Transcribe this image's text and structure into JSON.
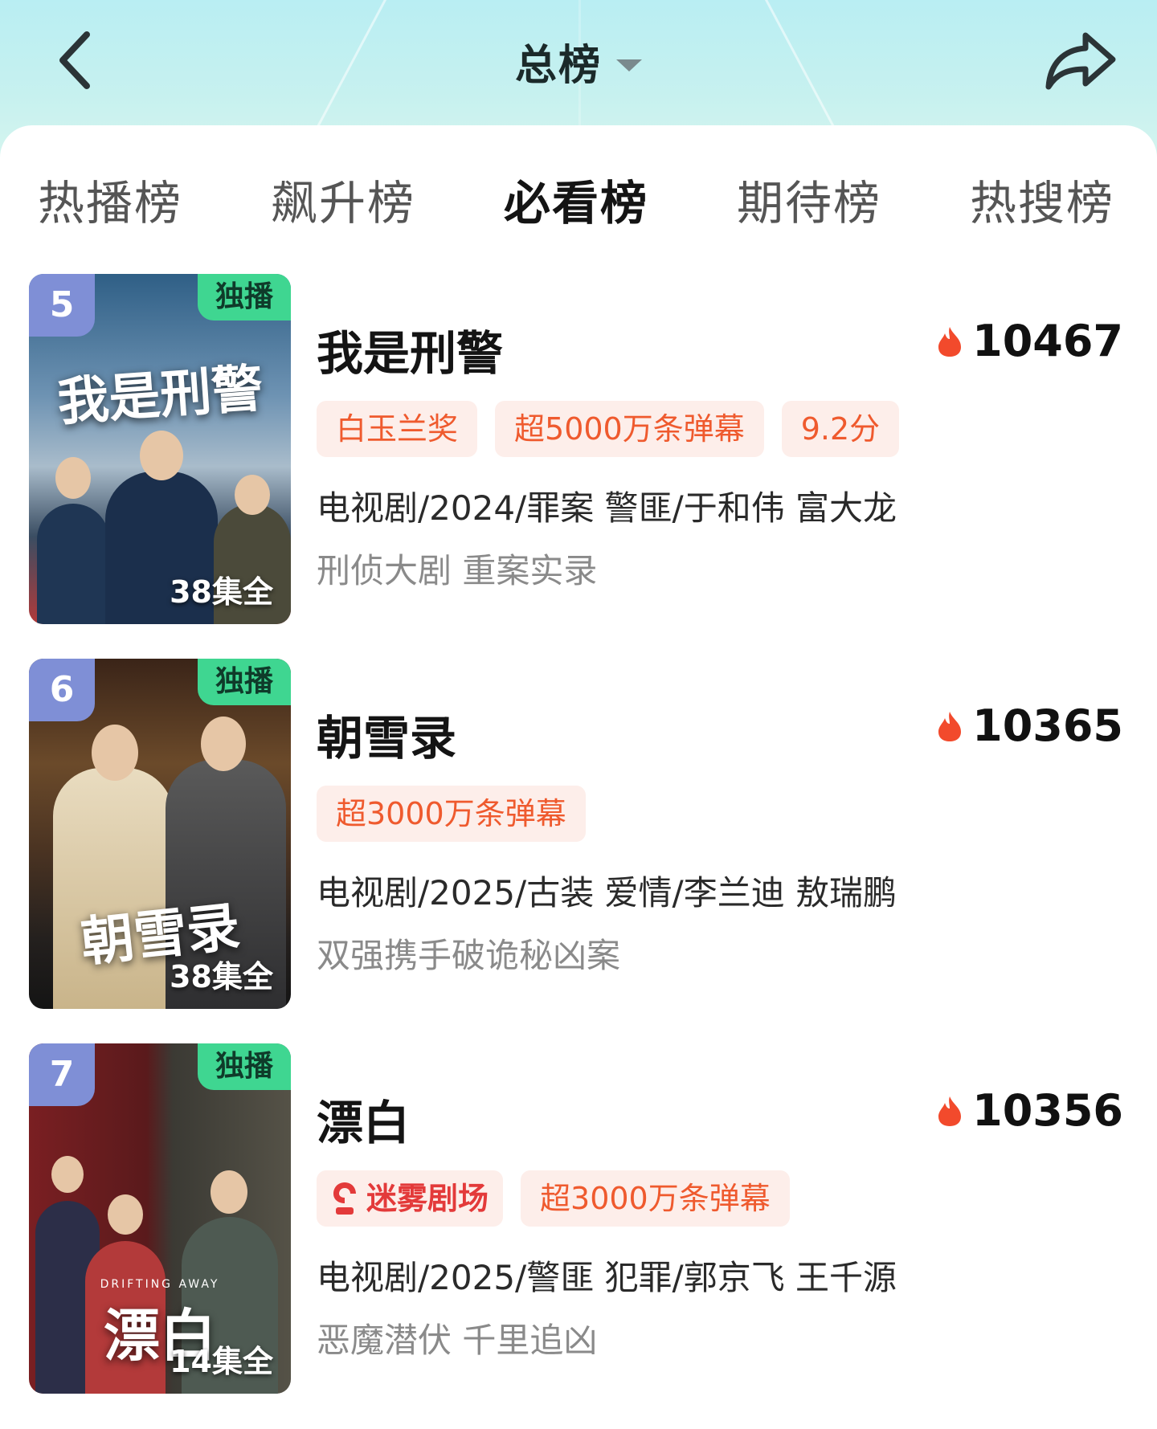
{
  "header": {
    "title": "总榜",
    "back_icon": "back-arrow-icon",
    "share_icon": "share-icon"
  },
  "tabs": [
    {
      "label": "热播榜",
      "active": false
    },
    {
      "label": "飙升榜",
      "active": false
    },
    {
      "label": "必看榜",
      "active": true
    },
    {
      "label": "期待榜",
      "active": false
    },
    {
      "label": "热搜榜",
      "active": false
    }
  ],
  "items": [
    {
      "rank": "5",
      "badge": "独播",
      "episodes": "38集全",
      "poster_title": "我是刑警",
      "name": "我是刑警",
      "heat": "10467",
      "tags": [
        "白玉兰奖",
        "超5000万条弹幕",
        "9.2分"
      ],
      "meta": "电视剧/2024/罪案 警匪/于和伟 富大龙",
      "desc": "刑侦大剧 重案实录"
    },
    {
      "rank": "6",
      "badge": "独播",
      "episodes": "38集全",
      "poster_title": "朝雪录",
      "name": "朝雪录",
      "heat": "10365",
      "tags": [
        "超3000万条弹幕"
      ],
      "meta": "电视剧/2025/古装 爱情/李兰迪 敖瑞鹏",
      "desc": "双强携手破诡秘凶案"
    },
    {
      "rank": "7",
      "badge": "独播",
      "episodes": "14集全",
      "poster_title": "漂白",
      "poster_subtitle": "DRIFTING AWAY",
      "name": "漂白",
      "heat": "10356",
      "theater_tag": "迷雾剧场",
      "tags": [
        "超3000万条弹幕"
      ],
      "meta": "电视剧/2025/警匪 犯罪/郭京飞 王千源",
      "desc": "恶魔潜伏 千里追凶"
    }
  ],
  "colors": {
    "accent_green": "#15c877",
    "rank_badge": "#7f8fd6",
    "exclusive_badge": "#3fd691",
    "tag_text": "#ef5a2e",
    "tag_bg": "#fdeeea",
    "heat_flame": "#f24a2c"
  }
}
